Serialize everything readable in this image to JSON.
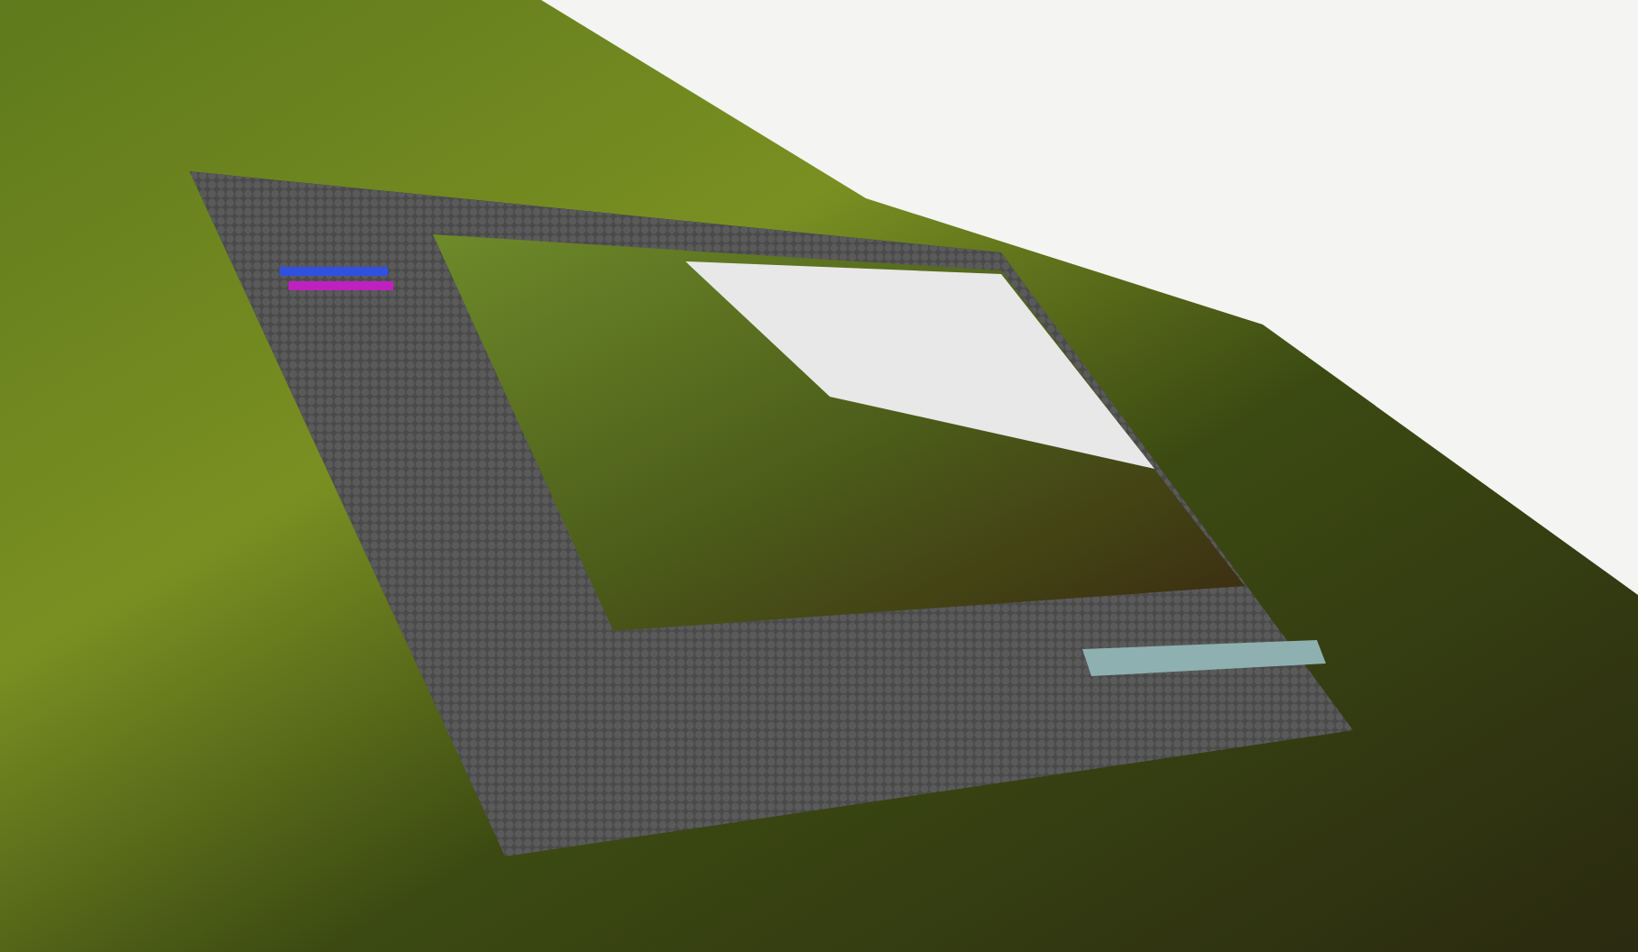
{
  "scene": {
    "kind": "photo"
  }
}
